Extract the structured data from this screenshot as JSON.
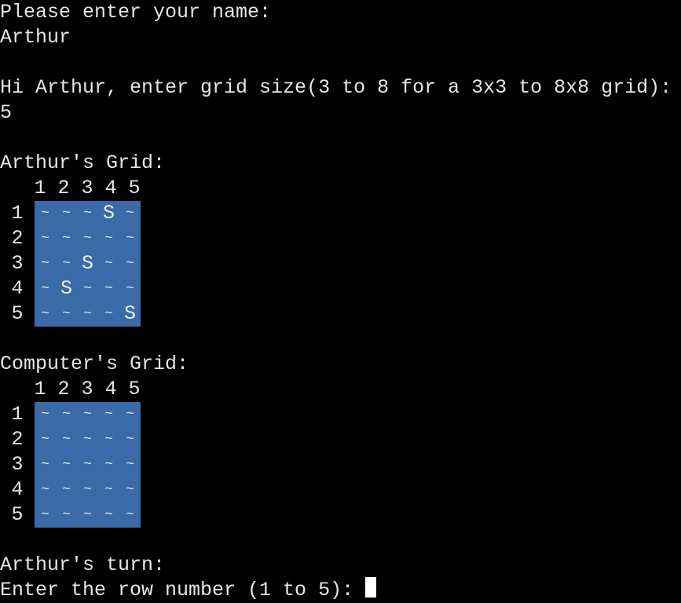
{
  "terminal": {
    "prompt_name": "Please enter your name:",
    "name_input": "Arthur",
    "prompt_size": "Hi Arthur, enter grid size(3 to 8 for a 3x3 to 8x8 grid):",
    "size_input": "5",
    "turn_line": "Arthur's turn:",
    "row_prompt": "Enter the row number (1 to 5): "
  },
  "player_grid": {
    "title": "Arthur's Grid:",
    "col_labels": [
      "1",
      "2",
      "3",
      "4",
      "5"
    ],
    "row_labels": [
      "1",
      "2",
      "3",
      "4",
      "5"
    ],
    "rows": [
      [
        "~",
        "~",
        "~",
        "S",
        "~"
      ],
      [
        "~",
        "~",
        "~",
        "~",
        "~"
      ],
      [
        "~",
        "~",
        "S",
        "~",
        "~"
      ],
      [
        "~",
        "S",
        "~",
        "~",
        "~"
      ],
      [
        "~",
        "~",
        "~",
        "~",
        "S"
      ]
    ]
  },
  "computer_grid": {
    "title": "Computer's Grid:",
    "col_labels": [
      "1",
      "2",
      "3",
      "4",
      "5"
    ],
    "row_labels": [
      "1",
      "2",
      "3",
      "4",
      "5"
    ],
    "rows": [
      [
        "~",
        "~",
        "~",
        "~",
        "~"
      ],
      [
        "~",
        "~",
        "~",
        "~",
        "~"
      ],
      [
        "~",
        "~",
        "~",
        "~",
        "~"
      ],
      [
        "~",
        "~",
        "~",
        "~",
        "~"
      ],
      [
        "~",
        "~",
        "~",
        "~",
        "~"
      ]
    ]
  },
  "colors": {
    "background": "#000000",
    "text": "#e6e6e6",
    "water": "#3a6aa8",
    "cursor": "#ffffff"
  }
}
